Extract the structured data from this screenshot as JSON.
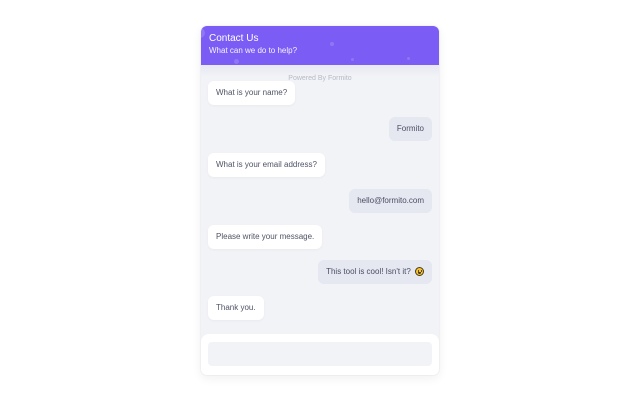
{
  "header": {
    "title": "Contact Us",
    "subtitle": "What can we do to help?"
  },
  "powered_by": "Powered By Formito",
  "messages": [
    {
      "from": "bot",
      "text": "What is your name?"
    },
    {
      "from": "user",
      "text": "Formito"
    },
    {
      "from": "bot",
      "text": "What is your email address?"
    },
    {
      "from": "user",
      "text": "hello@formito.com"
    },
    {
      "from": "bot",
      "text": "Please write your message."
    },
    {
      "from": "user",
      "text": "This tool is cool! Isn't it?",
      "icon": "grinning-face-emoji-icon"
    },
    {
      "from": "bot",
      "text": "Thank you."
    }
  ],
  "composer": {
    "value": "",
    "placeholder": ""
  },
  "colors": {
    "accent": "#7b5cf5",
    "chat_background": "#f2f3f7",
    "bot_bubble": "#ffffff",
    "user_bubble": "#e5e7f1"
  }
}
